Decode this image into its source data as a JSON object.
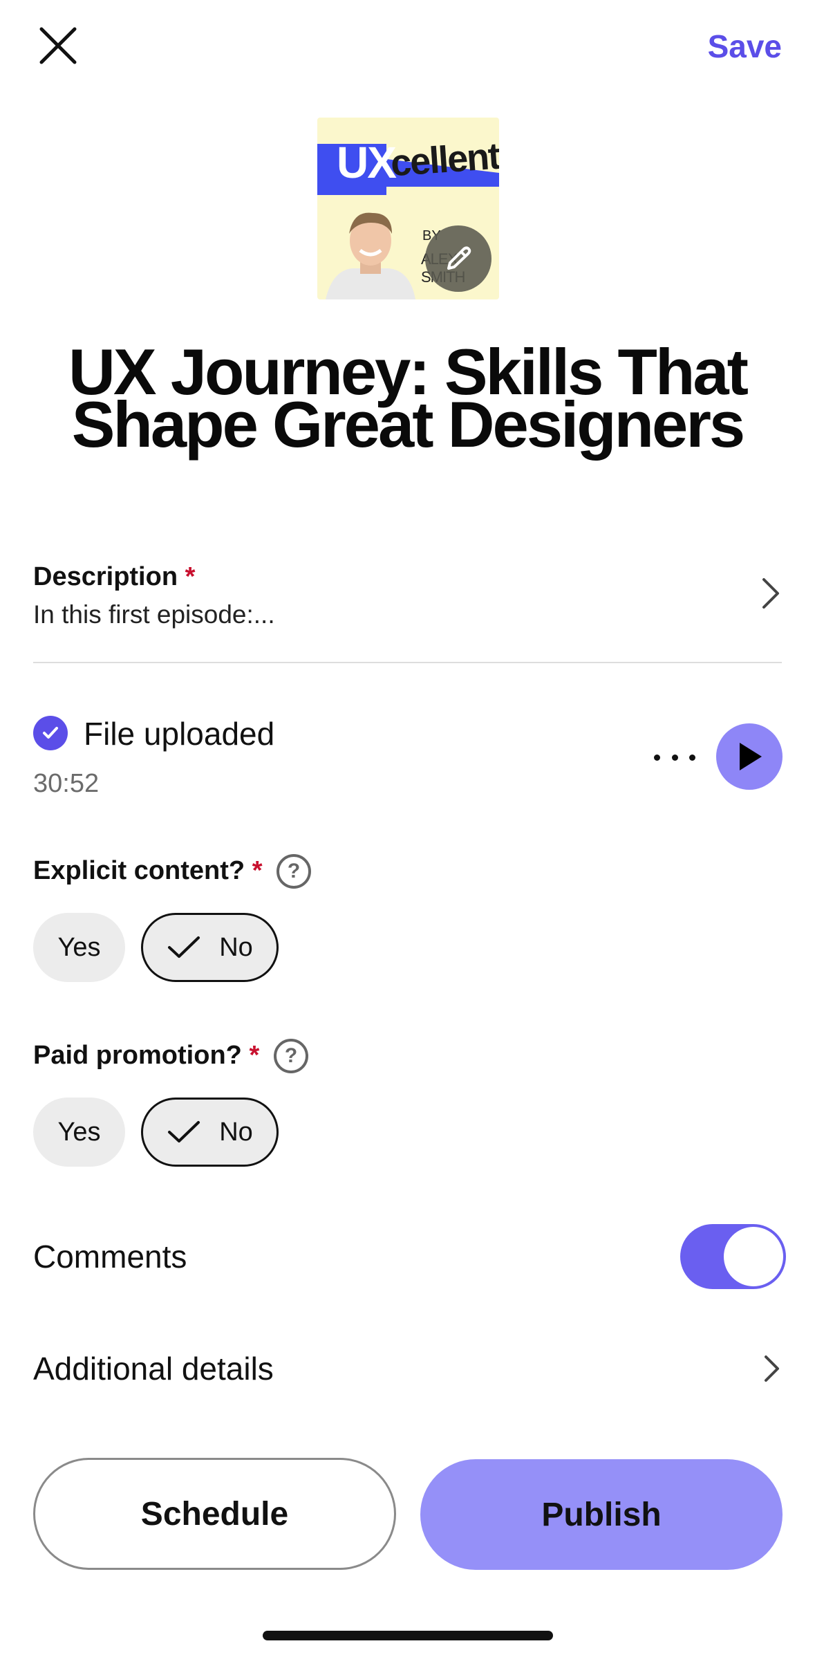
{
  "header": {
    "close_icon": "close-icon",
    "save_label": "Save"
  },
  "cover": {
    "logo_ux": "UX",
    "logo_cellent": "cellent",
    "by": "BY",
    "author": "ALEX SMITH",
    "edit_icon": "pencil-icon",
    "colors": {
      "background": "#fbf7cc",
      "band": "#3f4ef0"
    }
  },
  "episode": {
    "title": "UX Journey: Skills That Shape Great Designers"
  },
  "description": {
    "label": "Description",
    "required_mark": "*",
    "preview": "In this first episode:..."
  },
  "upload": {
    "status": "File uploaded",
    "duration": "30:52"
  },
  "explicit": {
    "label": "Explicit content?",
    "required_mark": "*",
    "help": "?",
    "options": [
      "Yes",
      "No"
    ],
    "selected": "No"
  },
  "promotion": {
    "label": "Paid promotion?",
    "required_mark": "*",
    "help": "?",
    "options": [
      "Yes",
      "No"
    ],
    "selected": "No"
  },
  "comments": {
    "label": "Comments",
    "enabled": true
  },
  "additional": {
    "label": "Additional details"
  },
  "actions": {
    "schedule_label": "Schedule",
    "publish_label": "Publish"
  },
  "colors": {
    "accent": "#5b4ee8",
    "publish": "#9590f8",
    "toggle_on": "#6a5ff0",
    "required": "#c8102e"
  }
}
